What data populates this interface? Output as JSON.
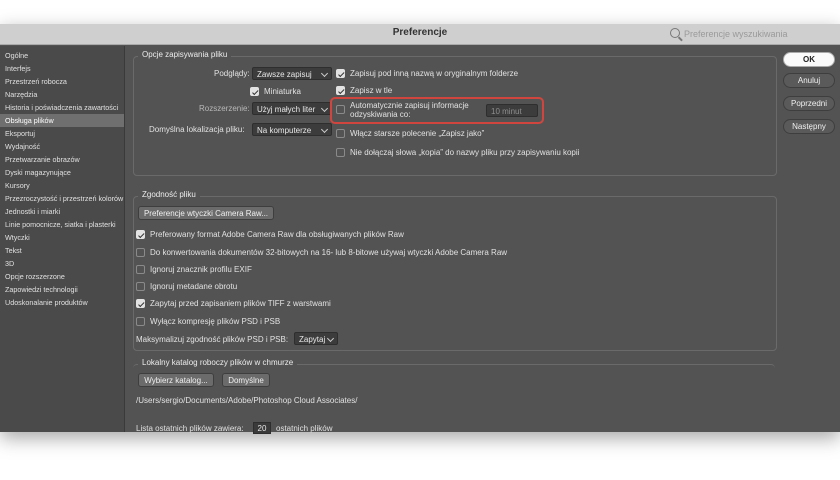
{
  "window": {
    "title": "Preferencje",
    "search_placeholder": "Preferencje wyszukiwania"
  },
  "sidebar": {
    "items": [
      "Ogólne",
      "Interfejs",
      "Przestrzeń robocza",
      "Narzędzia",
      "Historia i poświadczenia zawartości",
      "Obsługa plików",
      "Eksportuj",
      "Wydajność",
      "Przetwarzanie obrazów",
      "Dyski magazynujące",
      "Kursory",
      "Przezroczystość i przestrzeń kolorów",
      "Jednostki i miarki",
      "Linie pomocnicze, siatka i plasterki",
      "Wtyczki",
      "Tekst",
      "3D",
      "Opcje rozszerzone",
      "Zapowiedzi technologii",
      "Udoskonalanie produktów"
    ],
    "active": "Obsługa plików"
  },
  "save_options": {
    "title": "Opcje zapisywania pliku",
    "previews_label": "Podglądy:",
    "previews_value": "Zawsze zapisuj",
    "thumbnail_label": "Miniaturka",
    "extension_label": "Rozszerzenie:",
    "extension_value": "Użyj małych liter",
    "default_location_label": "Domyślna lokalizacja pliku:",
    "default_location_value": "Na komputerze",
    "save_original_folder": "Zapisuj pod inną nazwą w oryginalnym folderze",
    "save_background": "Zapisz w tle",
    "autosave_line1": "Automatycznie zapisuj informacje",
    "autosave_line2": "odzyskiwania co:",
    "autosave_value": "10 minut",
    "legacy_save_as": "Włącz starsze polecenie „Zapisz jako”",
    "no_copy_word": "Nie dołączaj słowa „kopia” do nazwy pliku przy zapisywaniu kopii"
  },
  "compatibility": {
    "title": "Zgodność pliku",
    "camera_raw_button": "Preferencje wtyczki Camera Raw...",
    "prefer_acr": "Preferowany format Adobe Camera Raw dla obsługiwanych plików Raw",
    "convert_32bit": "Do konwertowania dokumentów 32-bitowych na 16- lub 8-bitowe używaj wtyczki Adobe Camera Raw",
    "ignore_exif": "Ignoruj znacznik profilu EXIF",
    "ignore_rotation": "Ignoruj metadane obrotu",
    "ask_tiff": "Zapytaj przed zapisaniem plików TIFF z warstwami",
    "disable_psd_compression": "Wyłącz kompresję plików PSD i PSB",
    "max_compat_label": "Maksymalizuj zgodność plików PSD i PSB:",
    "max_compat_value": "Zapytaj"
  },
  "cloud": {
    "title": "Lokalny katalog roboczy plików w chmurze",
    "choose_button": "Wybierz katalog...",
    "defaults_button": "Domyślne",
    "path": "/Users/sergio/Documents/Adobe/Photoshop Cloud Associates/"
  },
  "recent": {
    "label_before": "Lista ostatnich plików zawiera:",
    "value": "20",
    "label_after": "ostatnich plików"
  },
  "buttons": {
    "ok": "OK",
    "cancel": "Anuluj",
    "prev": "Poprzedni",
    "next": "Następny"
  },
  "colors": {
    "highlight": "#d0463f",
    "panel": "#535353",
    "sidebar_active": "#6f6f6f"
  }
}
